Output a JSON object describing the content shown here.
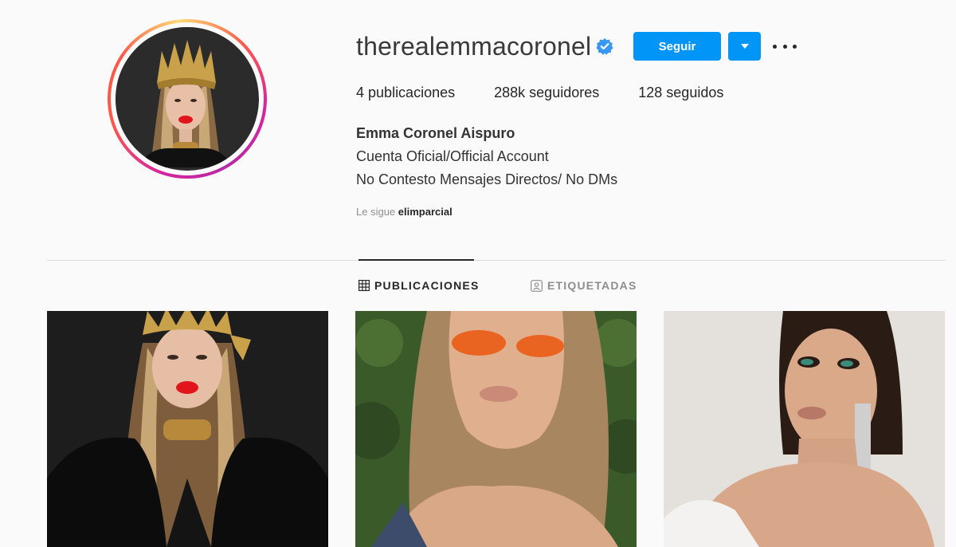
{
  "profile": {
    "username": "therealemmacoronel",
    "follow_label": "Seguir",
    "stats": {
      "posts_count": "4",
      "posts_label": "publicaciones",
      "followers_count": "288k",
      "followers_label": "seguidores",
      "following_count": "128",
      "following_label": "seguidos"
    },
    "full_name": "Emma Coronel Aispuro",
    "bio_line1": "Cuenta Oficial/Official Account",
    "bio_line2": "No Contesto Mensajes Directos/ No DMs",
    "followed_by_prefix": "Le sigue",
    "followed_by_user": "elimparcial"
  },
  "tabs": [
    {
      "label": "PUBLICACIONES",
      "icon": "grid-icon",
      "active": true
    },
    {
      "label": "ETIQUETADAS",
      "icon": "tagged-icon",
      "active": false
    }
  ],
  "colors": {
    "accent": "#0095f6",
    "verified": "#3897f0"
  }
}
